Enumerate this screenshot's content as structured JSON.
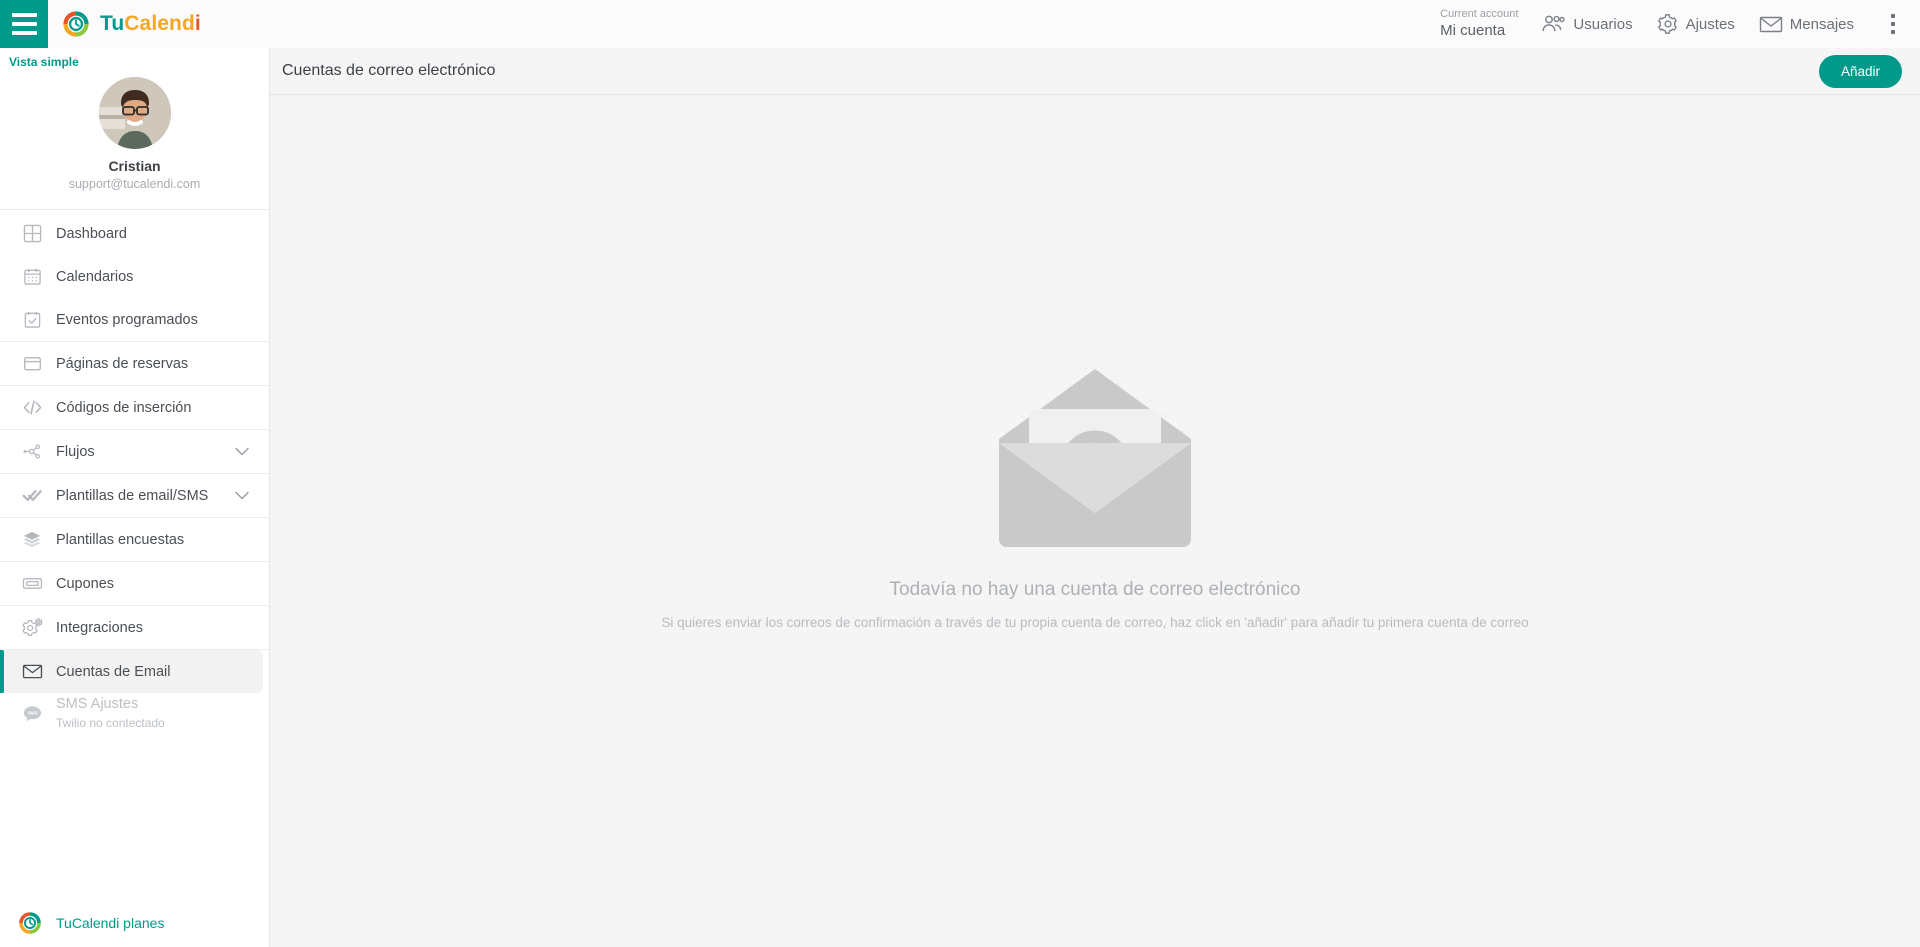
{
  "brand": {
    "part1": "Tu",
    "part2": "Calend",
    "part3": "i",
    "logo_icon": "tucalendi-logo-icon",
    "menu_icon": "hamburger-menu-icon"
  },
  "topbar": {
    "account_label": "Current account",
    "account_value": "Mi cuenta",
    "items": [
      {
        "label": "Usuarios",
        "icon": "users-icon"
      },
      {
        "label": "Ajustes",
        "icon": "gear-icon"
      },
      {
        "label": "Mensajes",
        "icon": "envelope-icon"
      }
    ],
    "kebab_icon": "more-vertical-icon"
  },
  "sidebar": {
    "simple_view": "Vista simple",
    "profile": {
      "name": "Cristian",
      "email": "support@tucalendi.com",
      "avatar": "user-avatar"
    },
    "groups": [
      {
        "items": [
          {
            "label": "Dashboard",
            "icon": "dashboard-grid-icon"
          },
          {
            "label": "Calendarios",
            "icon": "calendar-icon"
          },
          {
            "label": "Eventos programados",
            "icon": "calendar-check-icon"
          }
        ]
      },
      {
        "items": [
          {
            "label": "Páginas de reservas",
            "icon": "window-icon"
          }
        ]
      },
      {
        "items": [
          {
            "label": "Códigos de inserción",
            "icon": "code-icon"
          }
        ]
      },
      {
        "items": [
          {
            "label": "Flujos",
            "icon": "flow-nodes-icon",
            "chevron": true
          }
        ]
      },
      {
        "items": [
          {
            "label": "Plantillas de email/SMS",
            "icon": "double-check-icon",
            "chevron": true
          }
        ]
      },
      {
        "items": [
          {
            "label": "Plantillas encuestas",
            "icon": "layers-icon"
          }
        ]
      },
      {
        "items": [
          {
            "label": "Cupones",
            "icon": "ticket-icon"
          }
        ]
      },
      {
        "items": [
          {
            "label": "Integraciones",
            "icon": "gears-icon"
          }
        ]
      },
      {
        "items": [
          {
            "label": "Cuentas de Email",
            "icon": "mail-icon",
            "active": true
          },
          {
            "label": "SMS Ajustes",
            "sublabel": "Twilio no contectado",
            "icon": "sms-bubble-icon",
            "disabled": true
          }
        ]
      }
    ],
    "plans_link": "TuCalendi planes",
    "plans_icon": "tucalendi-logo-icon"
  },
  "main": {
    "title": "Cuentas de correo electrónico",
    "add_button": "Añadir",
    "empty_state": {
      "illustration": "open-envelope-at-icon",
      "title": "Todavía no hay una cuenta de correo electrónico",
      "subtitle": "Si quieres enviar los correos de confirmación a través de tu propia cuenta de correo, haz click en 'añadir' para añadir tu primera cuenta de correo"
    }
  },
  "colors": {
    "accent": "#00998a",
    "logo_red": "#e8552a",
    "logo_yellow": "#f5a623",
    "logo_green": "#8cc63f",
    "logo_teal": "#009b8c",
    "empty_gray": "#c9c9c9"
  }
}
